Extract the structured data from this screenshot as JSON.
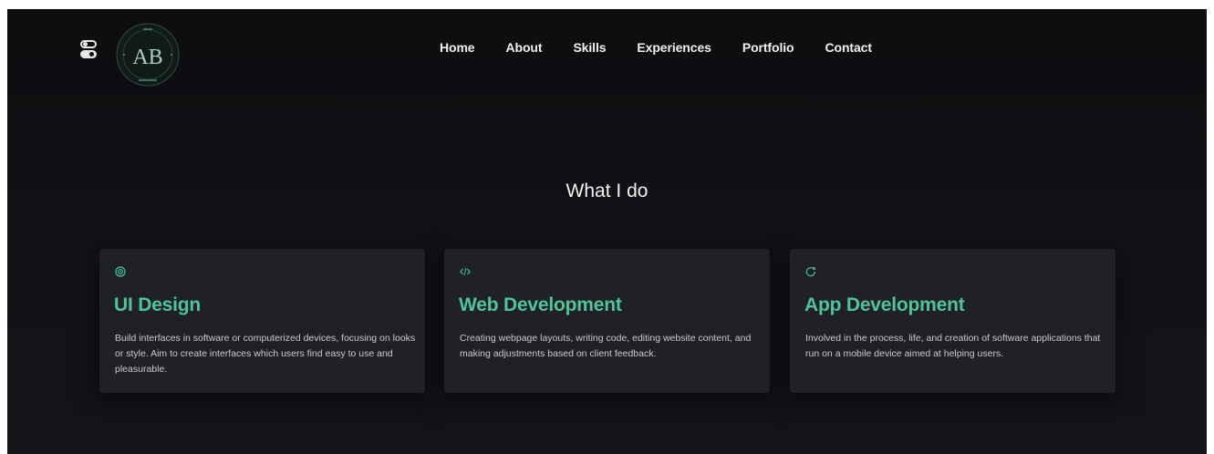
{
  "header": {
    "logo_text": "AB",
    "nav": [
      {
        "label": "Home"
      },
      {
        "label": "About"
      },
      {
        "label": "Skills"
      },
      {
        "label": "Experiences"
      },
      {
        "label": "Portfolio"
      },
      {
        "label": "Contact"
      }
    ],
    "theme_toggle_icon": "toggle-icon"
  },
  "section": {
    "title": "What I do",
    "cards": [
      {
        "icon": "target-icon",
        "title": "UI Design",
        "description": "Build interfaces in software or computerized devices, focusing on looks or style. Aim to create interfaces which users find easy to use and pleasurable."
      },
      {
        "icon": "code-icon",
        "title": "Web Development",
        "description": "Creating webpage layouts, writing code, editing website content, and making adjustments based on client feedback."
      },
      {
        "icon": "app-icon",
        "title": "App Development",
        "description": "Involved in the process, life, and creation of software applications that run on a mobile device aimed at helping users."
      }
    ]
  },
  "colors": {
    "background": "#0d0d10",
    "card_background": "#1f2126",
    "accent": "#4fc49a",
    "text": "#f0f0f0"
  }
}
